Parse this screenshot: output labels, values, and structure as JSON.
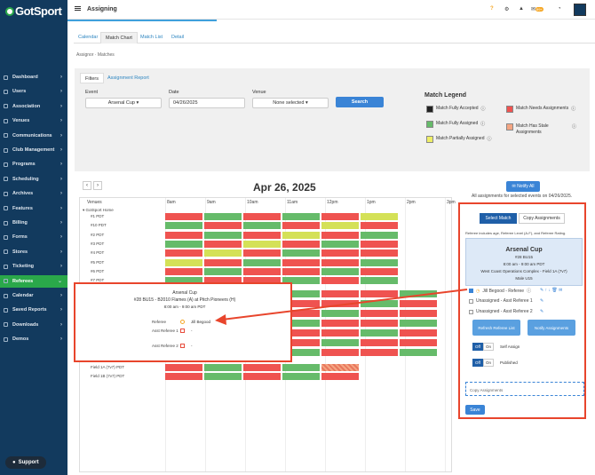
{
  "sidebar": {
    "logo": "GotSport",
    "items": [
      {
        "label": "Dashboard"
      },
      {
        "label": "Users"
      },
      {
        "label": "Association"
      },
      {
        "label": "Venues"
      },
      {
        "label": "Communications"
      },
      {
        "label": "Club Management"
      },
      {
        "label": "Programs"
      },
      {
        "label": "Scheduling"
      },
      {
        "label": "Archives"
      },
      {
        "label": "Features"
      },
      {
        "label": "Billing"
      },
      {
        "label": "Forms"
      },
      {
        "label": "Stores"
      },
      {
        "label": "Ticketing"
      },
      {
        "label": "Referees"
      },
      {
        "label": "Calendar"
      },
      {
        "label": "Saved Reports"
      },
      {
        "label": "Downloads"
      },
      {
        "label": "Demos"
      }
    ],
    "active": "Referees",
    "support": "Support"
  },
  "topbar": {
    "title": "Assigning",
    "badge": "99+"
  },
  "tabs": [
    {
      "label": "Calendar"
    },
    {
      "label": "Match Chart"
    },
    {
      "label": "Match List"
    },
    {
      "label": "Detail"
    }
  ],
  "breadcrumb": "Assignor  ·  Matches",
  "filters": {
    "tab_filters": "Filters",
    "tab_report": "Assignment Report",
    "event_label": "Event",
    "event_value": "Arsenal Cup",
    "date_label": "Date",
    "date_value": "04/26/2025",
    "venue_label": "Venue",
    "venue_value": "None selected",
    "search": "Search"
  },
  "legend": {
    "title": "Match Legend",
    "items": [
      {
        "label": "Match Fully Accepted",
        "color": "#222222"
      },
      {
        "label": "Match Fully Assigned",
        "color": "#66bb6a"
      },
      {
        "label": "Match Partially Assigned",
        "color": "#eeee66"
      },
      {
        "label": "Match Needs Assignments",
        "color": "#ef5350"
      },
      {
        "label": "Match Has Stale Assignments",
        "color": "#f4a582"
      }
    ]
  },
  "chart": {
    "date": "Apr 26, 2025",
    "notify_all": "Notify All",
    "all_assignments": "All assignments for selected events on 04/26/2025.",
    "venues_header": "Venues",
    "group": "GotSport Home",
    "hours": [
      "8am",
      "9am",
      "10am",
      "11am",
      "12pm",
      "1pm",
      "2pm",
      "3pm"
    ],
    "rows": [
      "#1 PDT",
      "#10 PDT",
      "#2 PDT",
      "#3 PDT",
      "#4 PDT",
      "#5 PDT",
      "#6 PDT",
      "#7 PDT"
    ],
    "bottom_rows": [
      "Field 1A (7v7) PDT",
      "Field 1B (7v7) PDT"
    ]
  },
  "panel": {
    "select_match": "Select Match",
    "copy_assignments": "Copy Assignments",
    "note": "Referee includes age, Referee Level (A-F), and Referee Rating.",
    "title": "Arsenal Cup",
    "line1": "#28 BU15",
    "line2": "8:00 am - 9:00 am PDT",
    "line3": "West Coast Operations Complex - Field 1A (7v7)",
    "line4": "Male U15",
    "assign1": "Jill Begood - Referee",
    "assign2": "Unassigned - Asst Referee 1",
    "assign3": "Unassigned - Asst Referee 2",
    "refresh": "Refresh Referee List",
    "notify": "Notify Assignments",
    "off": "Off",
    "on": "On",
    "self_assign": "Self Assign",
    "published": "Published",
    "copy_placeholder": "Copy Assignments",
    "save": "Save"
  },
  "popup": {
    "title": "Arsenal Cup",
    "match": "#28 BU15 - B2010 Flames (A) at Pitch Pioneers (H)",
    "time": "8:00 am - 9:00 am PDT",
    "referee_label": "Referee",
    "referee_value": "Jill Begood",
    "ar1_label": "Asst Referee 1",
    "ar1_value": "-",
    "ar2_label": "Asst Referee 2",
    "ar2_value": "-"
  }
}
